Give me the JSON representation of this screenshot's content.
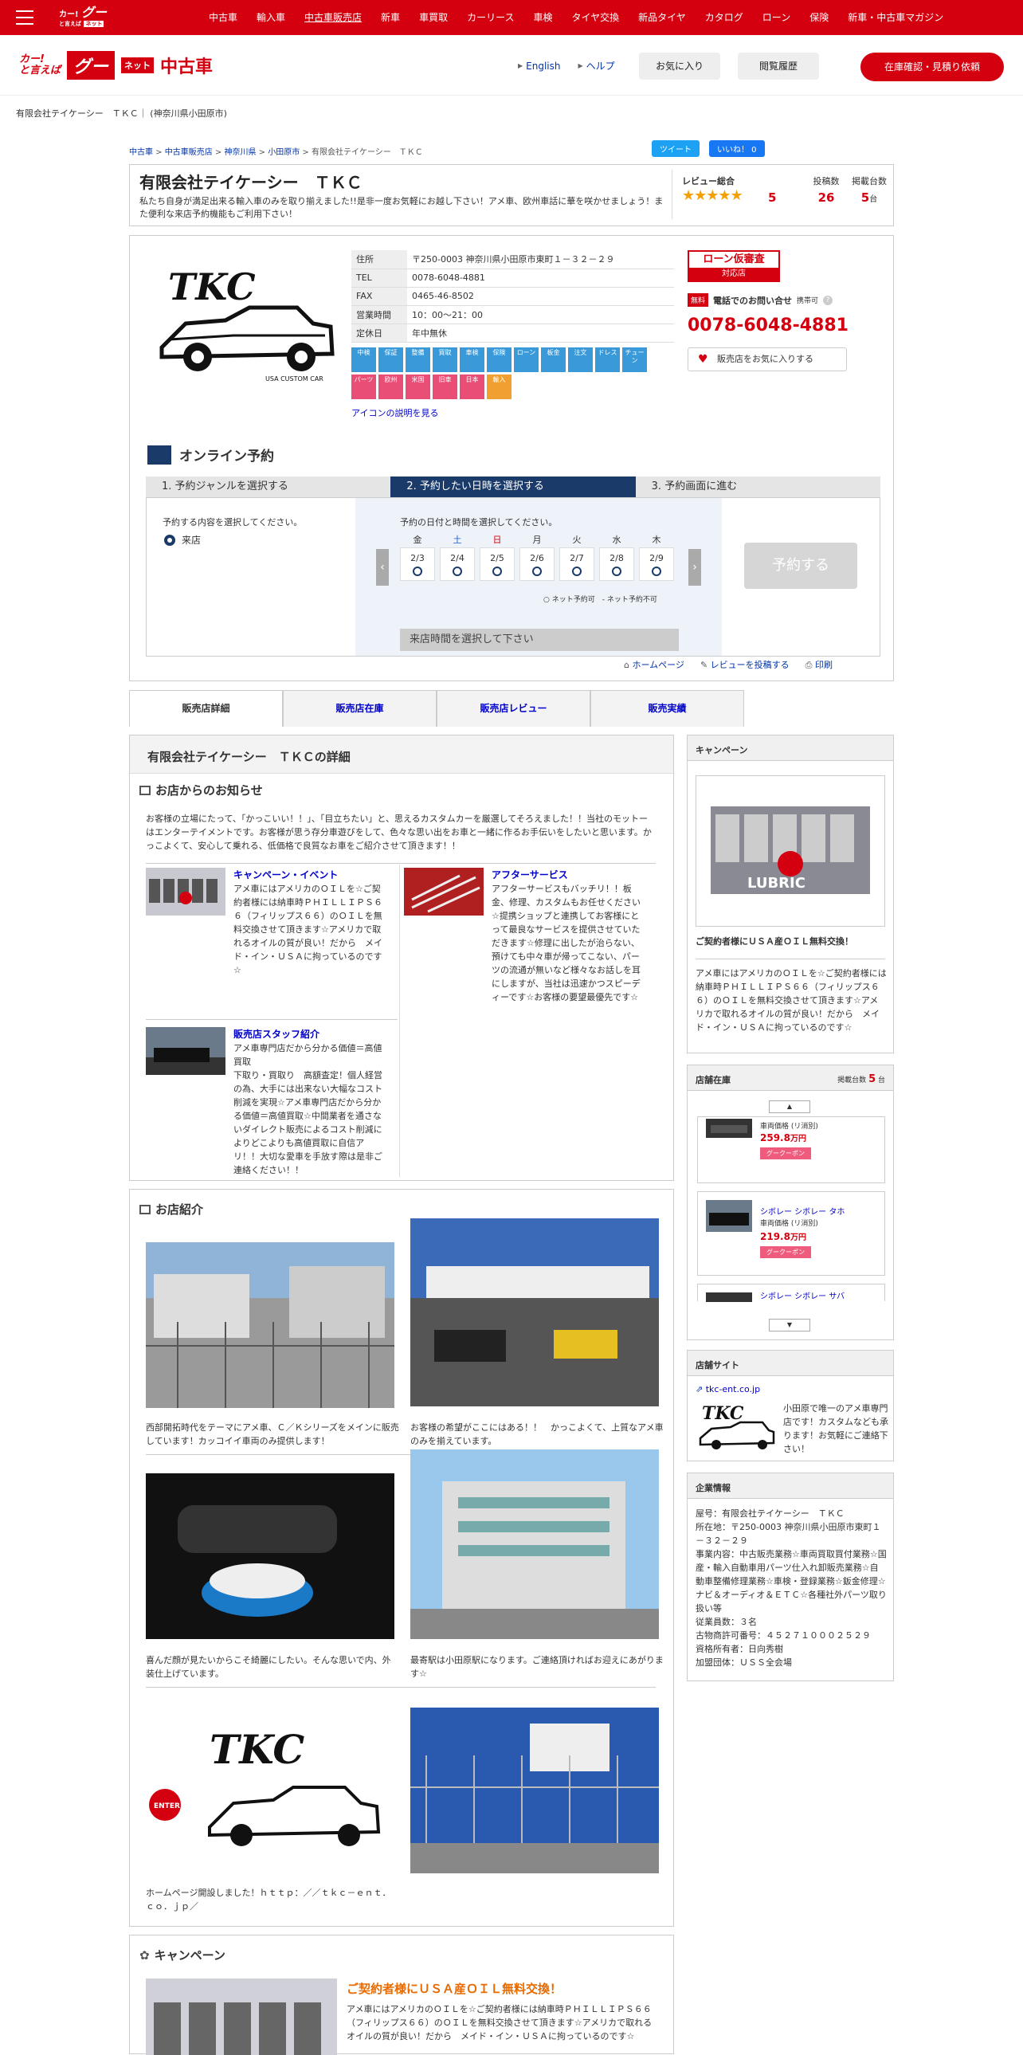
{
  "topbar": {
    "logo_line1": "カー!",
    "logo_line2": "と言えば",
    "logo_goo": "グー",
    "logo_net": "ネット",
    "nav": [
      "中古車",
      "輸入車",
      "中古車販売店",
      "新車",
      "車買取",
      "カーリース",
      "車検",
      "タイヤ交換",
      "新品タイヤ",
      "カタログ",
      "ローン",
      "保険",
      "新車・中古車マガジン"
    ]
  },
  "header": {
    "logo_kana": "カー!\nと言えば",
    "logo_goo": "グー",
    "logo_net": "ネット",
    "logo_used": "中古車",
    "english": "English",
    "help": "ヘルプ",
    "favorites": "お気に入り",
    "history": "閲覧履歴",
    "cta": "在庫確認・見積り依頼"
  },
  "subtitle": "有限会社テイケーシー　ＴＫＣ｜ (神奈川県小田原市)",
  "breadcrumb": [
    "中古車",
    "中古車販売店",
    "神奈川県",
    "小田原市",
    "有限会社テイケーシー　ＴＫＣ"
  ],
  "share": {
    "tweet": "ツイート",
    "like": "いいね！ 0"
  },
  "shop": {
    "name": "有限会社テイケーシー　ＴＫＣ",
    "description": "私たち自身が満足出来る輸入車のみを取り揃えました!!是非一度お気軽にお越し下さい！アメ車、欧州車話に華を咲かせましょう！また便利な来店予約機能もご利用下さい！",
    "review_label": "レビュー総合",
    "stars": "★★★★★",
    "review_value": "5",
    "posts_label": "投稿数",
    "posts_value": "26",
    "stock_label": "掲載台数",
    "stock_value": "5",
    "stock_unit": "台",
    "logo_text": "TKC",
    "logo_sub": "USA CUSTOM CAR"
  },
  "info": [
    {
      "k": "住所",
      "v": "〒250-0003 神奈川県小田原市東町１－３２－２９"
    },
    {
      "k": "TEL",
      "v": "0078-6048-4881"
    },
    {
      "k": "FAX",
      "v": "0465-46-8502"
    },
    {
      "k": "営業時間",
      "v": "10：00～21：00"
    },
    {
      "k": "定休日",
      "v": "年中無休"
    }
  ],
  "icons": [
    {
      "label": "中検",
      "color": "#3a9ad9"
    },
    {
      "label": "保証",
      "color": "#3a9ad9"
    },
    {
      "label": "整備",
      "color": "#3a9ad9"
    },
    {
      "label": "買取",
      "color": "#3a9ad9"
    },
    {
      "label": "車検",
      "color": "#3a9ad9"
    },
    {
      "label": "保険",
      "color": "#3a9ad9"
    },
    {
      "label": "ローン",
      "color": "#3a9ad9"
    },
    {
      "label": "板金",
      "color": "#3a9ad9"
    },
    {
      "label": "注文",
      "color": "#3a9ad9"
    },
    {
      "label": "ドレス",
      "color": "#3a9ad9"
    },
    {
      "label": "チューン",
      "color": "#3a9ad9"
    },
    {
      "label": "パーツ",
      "color": "#e94e77"
    },
    {
      "label": "欧州",
      "color": "#e94e77"
    },
    {
      "label": "米国",
      "color": "#e94e77"
    },
    {
      "label": "旧車",
      "color": "#e94e77"
    },
    {
      "label": "日本",
      "color": "#e94e77"
    },
    {
      "label": "輸入",
      "color": "#f0a030"
    }
  ],
  "icon_link": "アイコンの説明を見る",
  "loan": {
    "line1": "ローン仮審査",
    "line2": "対応店"
  },
  "phone": {
    "free": "無料",
    "label": "電話でのお問い合せ",
    "mobile": "携帯可",
    "number": "0078-6048-4881"
  },
  "fav_button": "販売店をお気に入りする",
  "reservation": {
    "title": "オンライン予約",
    "steps": [
      "1. 予約ジャンルを選択する",
      "2. 予約したい日時を選択する",
      "3. 予約画面に進む"
    ],
    "genre_prompt": "予約する内容を選択してください。",
    "genre_option": "来店",
    "date_prompt": "予約の日付と時間を選択してください。",
    "days": [
      {
        "w": "金",
        "d": "2/3",
        "c": "#333"
      },
      {
        "w": "土",
        "d": "2/4",
        "c": "#1a5ad5"
      },
      {
        "w": "日",
        "d": "2/5",
        "c": "#d5000f"
      },
      {
        "w": "月",
        "d": "2/6",
        "c": "#333"
      },
      {
        "w": "火",
        "d": "2/7",
        "c": "#333"
      },
      {
        "w": "水",
        "d": "2/8",
        "c": "#333"
      },
      {
        "w": "木",
        "d": "2/9",
        "c": "#333"
      }
    ],
    "legend": "○ ネット予約可　- ネット予約不可",
    "time_prompt": "来店時間を選択して下さい",
    "submit": "予約する"
  },
  "links": {
    "homepage": "ホームページ",
    "review": "レビューを投稿する",
    "print": "印刷"
  },
  "tabs": [
    "販売店詳細",
    "販売店在庫",
    "販売店レビュー",
    "販売実績"
  ],
  "detail": {
    "title": "有限会社テイケーシー　ＴＫＣの詳細",
    "notice_title": "お店からのお知らせ",
    "notice": "お客様の立場にたって、「かっこいい！！」、「目立ちたい」と、思えるカスタムカーを厳選してそろえました！！当社のモットーはエンターテイメントです。お客様が思う存分車遊びをして、色々な思い出をお車と一緒に作るお手伝いをしたいと思います。かっこよくて、安心して乗れる、低価格で良質なお車をご紹介させて頂きます！！",
    "news": [
      {
        "title": "キャンペーン・イベント",
        "text": "アメ車にはアメリカのＯＩＬを☆ご契約者様には納車時ＰＨＩＬＬＩＰＳ６６（フィリップス６６）のＯＩＬを無料交換させて頂きます☆アメリカで取れるオイルの質が良い！だから　メイド・イン・ＵＳＡに拘っているのです☆"
      },
      {
        "title": "アフターサービス",
        "text": "アフターサービスもバッチリ！！板金、修理、カスタムもお任せください☆提携ショップと連携してお客様にとって最良なサービスを提供させていただきます☆修理に出したが治らない、預けても中々車が帰ってこない、パーツの流通が無いなど様々なお話しを耳にしますが、当社は迅速かつスピーディーです☆お客様の要望最優先です☆"
      },
      {
        "title": "販売店スタッフ紹介",
        "text": "アメ車専門店だから分かる価値＝高値買取\n下取り・買取り　高額査定！個人経営の為、大手には出来ない大幅なコスト削減を実現☆アメ車専門店だから分かる価値＝高値買取☆中間業者を通さないダイレクト販売によるコスト削減によりどこよりも高値買取に自信アリ！！大切な愛車を手放す際は是非ご連絡ください！！"
      }
    ]
  },
  "intro": {
    "title": "お店紹介",
    "captions": [
      "西部開拓時代をテーマにアメ車、Ｃ／Ｋシリーズをメインに販売しています！カッコイイ車両のみ提供します！",
      "お客様の希望がここにはある！！　かっこよくて、上質なアメ車のみを揃えています。",
      "喜んだ顔が見たいからこそ綺麗にしたい。そんな思いで内、外装仕上げています。",
      "最寄駅は小田原駅になります。ご連絡頂ければお迎えにあがります☆",
      "ホームページ開設しました！ｈｔｔｐ：／／ｔｋｃ－ｅｎｔ．ｃｏ．ｊｐ／",
      ""
    ],
    "enter": "ENTER"
  },
  "campaign_main": {
    "title": "キャンペーン",
    "headline": "ご契約者様にＵＳＡ産ＯＩＬ無料交換！",
    "text": "アメ車にはアメリカのＯＩＬを☆ご契約者様には納車時ＰＨＩＬＬＩＰＳ６６（フィリップス６６）のＯＩＬを無料交換させて頂きます☆アメリカで取れるオイルの質が良い！だから　メイド・イン・ＵＳＡに拘っているのです☆"
  },
  "side": {
    "campaign": {
      "title": "キャンペーン",
      "headline": "ご契約者様にＵＳＡ産ＯＩＬ無料交換！",
      "text": "アメ車にはアメリカのＯＩＬを☆ご契約者様には納車時ＰＨＩＬＬＩＰＳ６６（フィリップス６６）のＯＩＬを無料交換させて頂きます☆アメリカで取れるオイルの質が良い！だから　メイド・イン・ＵＳＡに拘っているのです☆",
      "oil_label": "LUBRIC"
    },
    "stock": {
      "title": "店舗在庫",
      "count_label": "掲載台数",
      "count": "5",
      "unit": "台",
      "cars": [
        {
          "name": "",
          "price_label": "車両価格 (リ消別)",
          "price": "259.8",
          "unit": "万円",
          "coupon": "グークーポン"
        },
        {
          "name": "シボレー シボレー タホ",
          "price_label": "車両価格 (リ消別)",
          "price": "219.8",
          "unit": "万円",
          "coupon": "グークーポン"
        },
        {
          "name": "シボレー シボレー サバ",
          "price_label": "",
          "price": "",
          "unit": "",
          "coupon": ""
        }
      ]
    },
    "site": {
      "title": "店舗サイト",
      "url": "tkc-ent.co.jp",
      "text": "小田原で唯一のアメ車専門店です！カスタムなども承ります！お気軽にご連絡下さい！"
    },
    "corp": {
      "title": "企業情報",
      "text": "屋号：有限会社テイケーシー　ＴＫＣ\n所在地：〒250-0003 神奈川県小田原市東町１－３２－２９\n事業内容：中古販売業務☆車両買取買付業務☆国産・輸入自動車用パーツ仕入れ卸販売業務☆自動車整備修理業務☆車検・登録業務☆鈑金修理☆ナビ＆オーディオ＆ＥＴＣ☆各種社外パーツ取り扱い等\n従業員数：３名\n古物商許可番号：４５２７１０００２５２９\n資格所有者：日向秀樹\n加盟団体：ＵＳＳ全会場"
    }
  },
  "colors": {
    "brand": "#d5000f",
    "navy": "#1a3a6a",
    "link": "#0000cc",
    "accent": "#e86a00"
  }
}
